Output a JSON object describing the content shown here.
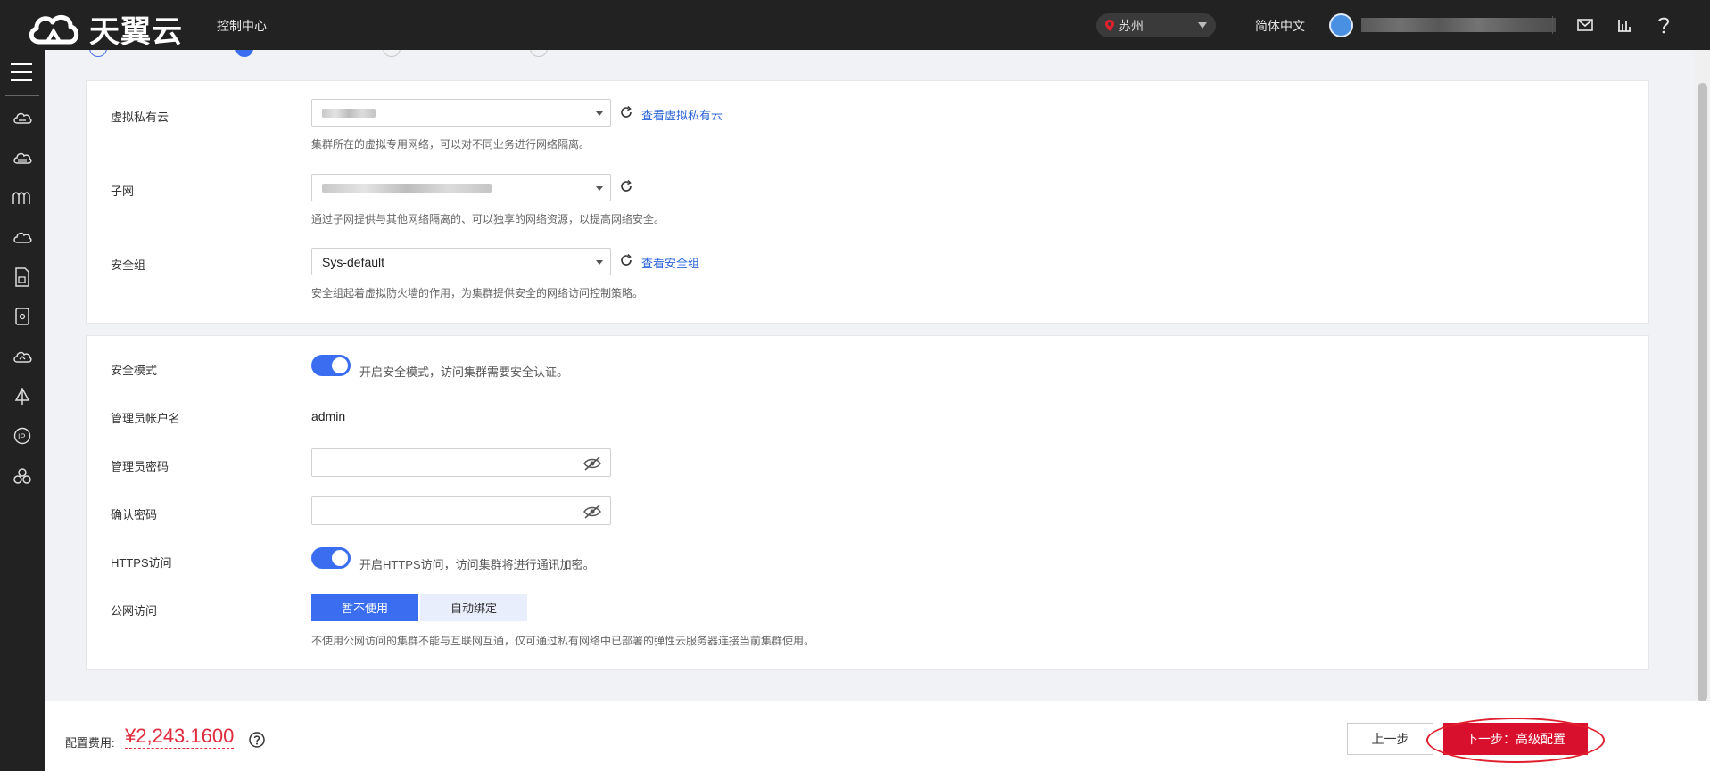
{
  "header": {
    "brand": "天翼云",
    "console_link": "控制中心",
    "region": "苏州",
    "language": "简体中文"
  },
  "network": {
    "vpc_label": "虚拟私有云",
    "vpc_hint": "集群所在的虚拟专用网络，可以对不同业务进行网络隔离。",
    "vpc_link": "查看虚拟私有云",
    "subnet_label": "子网",
    "subnet_hint": "通过子网提供与其他网络隔离的、可以独享的网络资源，以提高网络安全。",
    "sg_label": "安全组",
    "sg_value": "Sys-default",
    "sg_link": "查看安全组",
    "sg_hint": "安全组起着虚拟防火墙的作用，为集群提供安全的网络访问控制策略。"
  },
  "security": {
    "mode_label": "安全模式",
    "mode_text": "开启安全模式，访问集群需要安全认证。",
    "admin_label": "管理员帐户名",
    "admin_value": "admin",
    "password_label": "管理员密码",
    "confirm_label": "确认密码",
    "https_label": "HTTPS访问",
    "https_text": "开启HTTPS访问，访问集群将进行通讯加密。",
    "public_label": "公网访问",
    "public_options": [
      "暂不使用",
      "自动绑定"
    ],
    "public_selected": "暂不使用",
    "public_hint": "不使用公网访问的集群不能与互联网互通，仅可通过私有网络中已部署的弹性云服务器连接当前集群使用。"
  },
  "footer": {
    "fee_label": "配置费用:",
    "fee_value": "¥2,243.1600",
    "prev_button": "上一步",
    "next_button": "下一步：高级配置"
  },
  "colors": {
    "primary": "#3a6df0",
    "danger": "#d8102e",
    "price": "#e02b3d",
    "link": "#2a64d9",
    "topbar": "#222222"
  }
}
